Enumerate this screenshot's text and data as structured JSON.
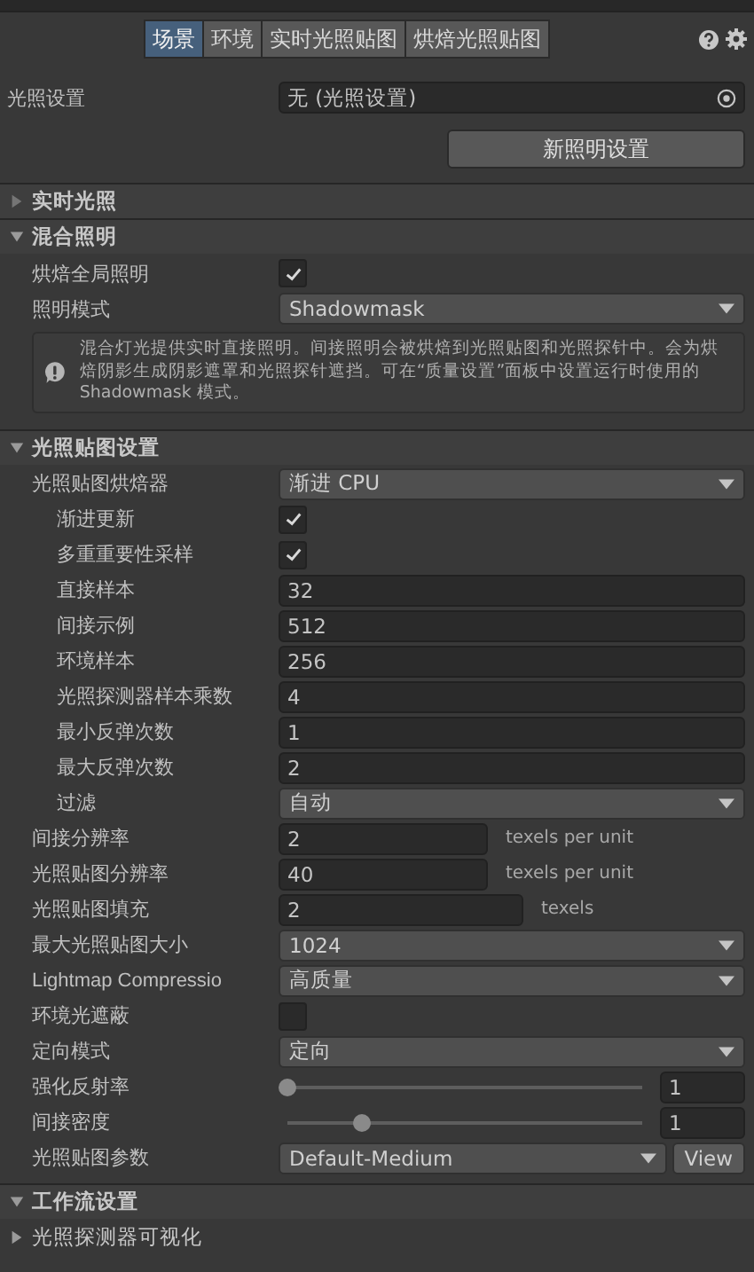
{
  "tabs": [
    {
      "label": "场景",
      "selected": true
    },
    {
      "label": "环境",
      "selected": false
    },
    {
      "label": "实时光照贴图",
      "selected": false
    },
    {
      "label": "烘焙光照贴图",
      "selected": false
    }
  ],
  "lighting_settings": {
    "label": "光照设置",
    "value": "无 (光照设置)"
  },
  "new_button": "新照明设置",
  "sections": [
    {
      "title": "实时光照",
      "expanded": false
    },
    {
      "title": "混合照明",
      "expanded": true,
      "rows": [
        {
          "kind": "checkbox",
          "label": "烘焙全局照明",
          "checked": true
        },
        {
          "kind": "dropdown",
          "label": "照明模式",
          "value": "Shadowmask"
        },
        {
          "kind": "help",
          "text": "混合灯光提供实时直接照明。间接照明会被烘焙到光照贴图和光照探针中。会为烘焙阴影生成阴影遮罩和光照探针遮挡。可在“质量设置”面板中设置运行时使用的 Shadowmask 模式。"
        }
      ]
    },
    {
      "title": "光照贴图设置",
      "expanded": true,
      "rows": [
        {
          "kind": "dropdown",
          "label": "光照贴图烘焙器",
          "value": "渐进 CPU",
          "children": [
            {
              "kind": "checkbox",
              "label": "渐进更新",
              "checked": true
            },
            {
              "kind": "checkbox",
              "label": "多重重要性采样",
              "checked": true
            },
            {
              "kind": "number",
              "label": "直接样本",
              "value": "32"
            },
            {
              "kind": "number",
              "label": "间接示例",
              "value": "512"
            },
            {
              "kind": "number",
              "label": "环境样本",
              "value": "256"
            },
            {
              "kind": "number",
              "label": "光照探测器样本乘数",
              "value": "4"
            },
            {
              "kind": "number",
              "label": "最小反弹次数",
              "value": "1"
            },
            {
              "kind": "number",
              "label": "最大反弹次数",
              "value": "2"
            },
            {
              "kind": "dropdown",
              "label": "过滤",
              "value": "自动"
            }
          ]
        },
        {
          "kind": "number",
          "label": "间接分辨率",
          "value": "2",
          "unit": "texels per unit"
        },
        {
          "kind": "number",
          "label": "光照贴图分辨率",
          "value": "40",
          "unit": "texels per unit"
        },
        {
          "kind": "number",
          "label": "光照贴图填充",
          "value": "2",
          "unit": "texels"
        },
        {
          "kind": "dropdown",
          "label": "最大光照贴图大小",
          "value": "1024"
        },
        {
          "kind": "dropdown",
          "label": "Lightmap Compressio",
          "value": "高质量"
        },
        {
          "kind": "checkbox",
          "label": "环境光遮蔽",
          "checked": false
        },
        {
          "kind": "dropdown",
          "label": "定向模式",
          "value": "定向"
        },
        {
          "kind": "slider",
          "label": "强化反射率",
          "level": 0,
          "value": "1"
        },
        {
          "kind": "slider",
          "label": "间接密度",
          "level": 0.2,
          "value": "1"
        },
        {
          "kind": "asset",
          "label": "光照贴图参数",
          "value": "Default-Medium",
          "button": "View"
        }
      ]
    },
    {
      "title": "工作流设置",
      "expanded": true,
      "rows": [
        {
          "kind": "foldout",
          "label": "光照探测器可视化",
          "expanded": false
        }
      ]
    }
  ]
}
